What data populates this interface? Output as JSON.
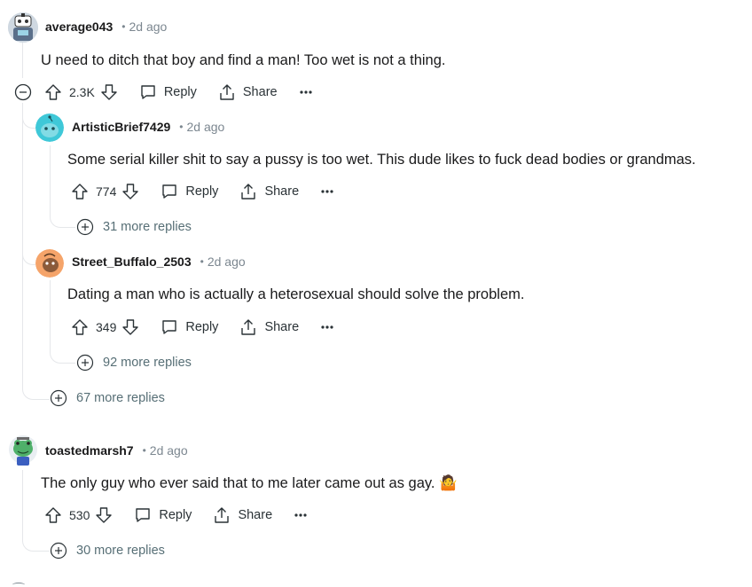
{
  "comments": [
    {
      "author": "average043",
      "time": "2d ago",
      "text": "U need to ditch that boy and find a man! Too wet is not a thing.",
      "score": "2.3K",
      "reply_label": "Reply",
      "share_label": "Share",
      "avatar_icon": "robot-avatar-icon",
      "replies": [
        {
          "author": "ArtisticBrief7429",
          "time": "2d ago",
          "text": "Some serial killer shit to say a pussy is too wet. This dude likes to fuck dead bodies or grandmas.",
          "score": "774",
          "reply_label": "Reply",
          "share_label": "Share",
          "more_replies": "31 more replies",
          "avatar_color": "#3fc8d8"
        },
        {
          "author": "Street_Buffalo_2503",
          "time": "2d ago",
          "text": "Dating a man who is actually a heterosexual should solve the problem.",
          "score": "349",
          "reply_label": "Reply",
          "share_label": "Share",
          "more_replies": "92 more replies",
          "avatar_color": "#f5a46a"
        }
      ],
      "more_replies": "67 more replies"
    },
    {
      "author": "toastedmarsh7",
      "time": "2d ago",
      "text": "The only guy who ever said that to me later came out as gay. 🤷",
      "score": "530",
      "reply_label": "Reply",
      "share_label": "Share",
      "more_replies": "30 more replies",
      "avatar_icon": "frog-avatar-icon"
    }
  ],
  "colors": {
    "meta_gray": "#7c8790",
    "thread_line": "#e5e7ea",
    "text": "#1a1a1b"
  }
}
